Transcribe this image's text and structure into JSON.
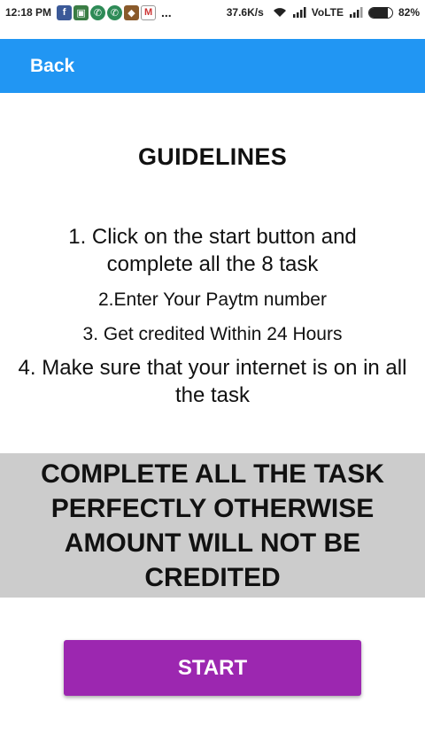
{
  "status_bar": {
    "time": "12:18 PM",
    "dots": "...",
    "speed": "37.6K/s",
    "network": "VoLTE",
    "battery": "82%",
    "battery_level": 0.82,
    "icons": [
      "facebook-icon",
      "app-icon",
      "whatsapp-icon",
      "whatsapp-icon",
      "game-icon",
      "gmail-icon",
      "wifi-icon",
      "signal-icon",
      "battery-icon"
    ]
  },
  "header": {
    "back_label": "Back",
    "color": "#2196f3"
  },
  "main": {
    "title": "GUIDELINES",
    "guidelines": [
      "1. Click on the start button  and complete all the 8 task",
      "2.Enter Your Paytm number",
      "3. Get credited Within 24 Hours",
      "4. Make sure that your internet is on in all the task"
    ],
    "warning": "COMPLETE ALL THE TASK PERFECTLY OTHERWISE AMOUNT WILL NOT BE CREDITED",
    "start_label": "START",
    "start_color": "#9c27b0"
  }
}
